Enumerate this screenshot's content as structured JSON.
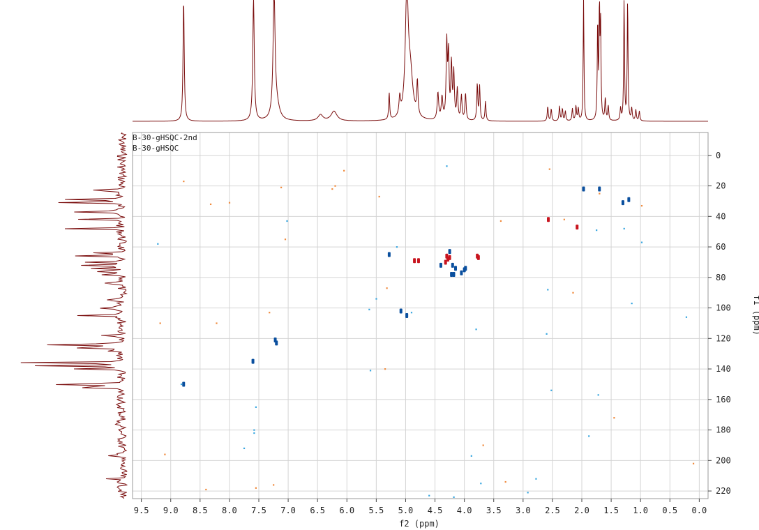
{
  "legend": [
    "B-30-gHSQC-2nd",
    "B-30-gHSQC"
  ],
  "colors": {
    "spectrum": "#7a0d0d",
    "grid": "#d4d4d4",
    "frame": "#9a9a9a",
    "pos_strong": "#c8141e",
    "pos_weak": "#f08a3c",
    "neg_strong": "#0a4f9e",
    "neg_weak": "#39a7e0"
  },
  "chart_data": {
    "type": "scatter",
    "title": "",
    "xlabel": "f2 (ppm)",
    "ylabel": "f1 (ppm)",
    "x_reversed": true,
    "y_reversed": true,
    "xlim": [
      9.65,
      -0.15
    ],
    "ylim": [
      -15,
      225
    ],
    "xticks": [
      "9.5",
      "9.0",
      "8.5",
      "8.0",
      "7.5",
      "7.0",
      "6.5",
      "6.0",
      "5.5",
      "5.0",
      "4.5",
      "4.0",
      "3.5",
      "3.0",
      "2.5",
      "2.0",
      "1.5",
      "1.0",
      "0.5",
      "0.0"
    ],
    "yticks": [
      "0",
      "20",
      "40",
      "60",
      "80",
      "100",
      "120",
      "140",
      "160",
      "180",
      "200",
      "220"
    ],
    "grid": true,
    "legend_position": "top-left",
    "series": [
      {
        "name": "B-30-gHSQC-2nd",
        "phase": "positive",
        "points": [
          [
            4.3,
            66
          ],
          [
            4.28,
            68
          ],
          [
            4.32,
            70
          ],
          [
            4.25,
            67
          ],
          [
            3.78,
            66
          ],
          [
            3.76,
            67
          ],
          [
            4.78,
            69
          ],
          [
            2.57,
            42
          ],
          [
            2.08,
            47
          ],
          [
            4.85,
            69
          ]
        ]
      },
      {
        "name": "B-30-gHSQC",
        "phase": "negative",
        "points": [
          [
            5.28,
            65
          ],
          [
            4.4,
            72
          ],
          [
            4.25,
            63
          ],
          [
            4.2,
            72
          ],
          [
            4.15,
            74
          ],
          [
            4.18,
            78
          ],
          [
            4.05,
            77
          ],
          [
            4.0,
            75
          ],
          [
            3.98,
            74
          ],
          [
            4.22,
            78
          ],
          [
            5.08,
            102
          ],
          [
            4.98,
            105
          ],
          [
            7.2,
            123
          ],
          [
            7.6,
            135
          ],
          [
            8.78,
            150
          ],
          [
            1.97,
            22
          ],
          [
            1.7,
            22
          ],
          [
            1.2,
            29
          ],
          [
            1.3,
            31
          ],
          [
            7.22,
            121
          ]
        ]
      }
    ],
    "weak_points": [
      [
        8.78,
        17,
        "o"
      ],
      [
        8.32,
        32,
        "o"
      ],
      [
        8.0,
        31,
        "o"
      ],
      [
        6.2,
        20,
        "o"
      ],
      [
        6.25,
        22,
        "o"
      ],
      [
        6.05,
        10,
        "o"
      ],
      [
        5.45,
        27,
        "o"
      ],
      [
        2.55,
        9,
        "o"
      ],
      [
        2.3,
        42,
        "o"
      ],
      [
        1.7,
        25,
        "o"
      ],
      [
        0.98,
        33,
        "o"
      ],
      [
        3.38,
        43,
        "o"
      ],
      [
        9.18,
        110,
        "o"
      ],
      [
        8.22,
        110,
        "o"
      ],
      [
        7.32,
        103,
        "o"
      ],
      [
        5.32,
        87,
        "o"
      ],
      [
        5.35,
        140,
        "o"
      ],
      [
        2.15,
        90,
        "o"
      ],
      [
        9.1,
        196,
        "o"
      ],
      [
        8.4,
        219,
        "o"
      ],
      [
        7.55,
        218,
        "o"
      ],
      [
        7.25,
        216,
        "o"
      ],
      [
        3.3,
        214,
        "o"
      ],
      [
        3.68,
        190,
        "o"
      ],
      [
        1.45,
        172,
        "o"
      ],
      [
        0.1,
        202,
        "o"
      ],
      [
        7.05,
        55,
        "o"
      ],
      [
        7.12,
        21,
        "o"
      ],
      [
        9.22,
        58,
        "b"
      ],
      [
        7.02,
        43,
        "b"
      ],
      [
        4.3,
        7,
        "b"
      ],
      [
        1.28,
        48,
        "b"
      ],
      [
        0.98,
        57,
        "b"
      ],
      [
        2.58,
        88,
        "b"
      ],
      [
        1.15,
        97,
        "b"
      ],
      [
        5.62,
        101,
        "b"
      ],
      [
        4.9,
        103,
        "b"
      ],
      [
        3.8,
        114,
        "b"
      ],
      [
        2.6,
        117,
        "b"
      ],
      [
        5.6,
        141,
        "b"
      ],
      [
        8.82,
        150,
        "b"
      ],
      [
        7.58,
        180,
        "b"
      ],
      [
        7.58,
        182,
        "b"
      ],
      [
        7.55,
        165,
        "b"
      ],
      [
        7.75,
        192,
        "b"
      ],
      [
        1.72,
        157,
        "b"
      ],
      [
        1.88,
        184,
        "b"
      ],
      [
        2.52,
        154,
        "b"
      ],
      [
        2.92,
        221,
        "b"
      ],
      [
        2.78,
        212,
        "b"
      ],
      [
        3.72,
        215,
        "b"
      ],
      [
        4.6,
        223,
        "b"
      ],
      [
        4.18,
        224,
        "b"
      ],
      [
        3.88,
        197,
        "b"
      ],
      [
        0.22,
        106,
        "b"
      ],
      [
        1.75,
        49,
        "b"
      ],
      [
        5.5,
        94,
        "b"
      ],
      [
        5.15,
        60,
        "b"
      ]
    ],
    "top_projection": {
      "peaks": [
        [
          8.78,
          1.0,
          0.012
        ],
        [
          7.59,
          1.0,
          0.015
        ],
        [
          7.24,
          1.0,
          0.02
        ],
        [
          7.2,
          0.12,
          0.06
        ],
        [
          6.45,
          0.05,
          0.05
        ],
        [
          6.22,
          0.08,
          0.06
        ],
        [
          5.28,
          0.22,
          0.01
        ],
        [
          5.1,
          0.15,
          0.015
        ],
        [
          4.98,
          1.0,
          0.03
        ],
        [
          4.92,
          0.35,
          0.05
        ],
        [
          4.8,
          0.28,
          0.012
        ],
        [
          4.45,
          0.22,
          0.015
        ],
        [
          4.38,
          0.18,
          0.015
        ],
        [
          4.3,
          0.62,
          0.012
        ],
        [
          4.27,
          0.52,
          0.012
        ],
        [
          4.22,
          0.45,
          0.012
        ],
        [
          4.18,
          0.38,
          0.012
        ],
        [
          4.12,
          0.25,
          0.012
        ],
        [
          4.05,
          0.2,
          0.012
        ],
        [
          3.98,
          0.22,
          0.012
        ],
        [
          3.78,
          0.3,
          0.01
        ],
        [
          3.74,
          0.28,
          0.01
        ],
        [
          3.64,
          0.16,
          0.01
        ],
        [
          2.58,
          0.12,
          0.01
        ],
        [
          2.52,
          0.1,
          0.01
        ],
        [
          2.38,
          0.12,
          0.01
        ],
        [
          2.33,
          0.1,
          0.01
        ],
        [
          2.28,
          0.08,
          0.01
        ],
        [
          2.16,
          0.1,
          0.01
        ],
        [
          2.1,
          0.12,
          0.01
        ],
        [
          2.06,
          0.1,
          0.01
        ],
        [
          1.97,
          1.0,
          0.008
        ],
        [
          1.73,
          0.8,
          0.008
        ],
        [
          1.7,
          0.9,
          0.008
        ],
        [
          1.68,
          0.75,
          0.008
        ],
        [
          1.6,
          0.18,
          0.01
        ],
        [
          1.55,
          0.12,
          0.01
        ],
        [
          1.34,
          0.1,
          0.01
        ],
        [
          1.28,
          1.0,
          0.008
        ],
        [
          1.22,
          1.0,
          0.008
        ],
        [
          1.15,
          0.1,
          0.01
        ],
        [
          1.08,
          0.09,
          0.01
        ],
        [
          1.02,
          0.08,
          0.01
        ]
      ]
    },
    "left_projection": {
      "peaks": [
        [
          23,
          108
        ],
        [
          29,
          98
        ],
        [
          31,
          95
        ],
        [
          37,
          75
        ],
        [
          42,
          72
        ],
        [
          48,
          90
        ],
        [
          64,
          62
        ],
        [
          66,
          68
        ],
        [
          70,
          58
        ],
        [
          72,
          66
        ],
        [
          74,
          62
        ],
        [
          76,
          64
        ],
        [
          78,
          58
        ],
        [
          84,
          44
        ],
        [
          95,
          48
        ],
        [
          100,
          52
        ],
        [
          105,
          58
        ],
        [
          124,
          182
        ],
        [
          126,
          140
        ],
        [
          128,
          40
        ],
        [
          136,
          182
        ],
        [
          138,
          140
        ],
        [
          140,
          68
        ],
        [
          150,
          182
        ],
        [
          152,
          140
        ],
        [
          118,
          30
        ],
        [
          163,
          30
        ],
        [
          176,
          30
        ],
        [
          197,
          22
        ],
        [
          212,
          26
        ]
      ]
    }
  }
}
